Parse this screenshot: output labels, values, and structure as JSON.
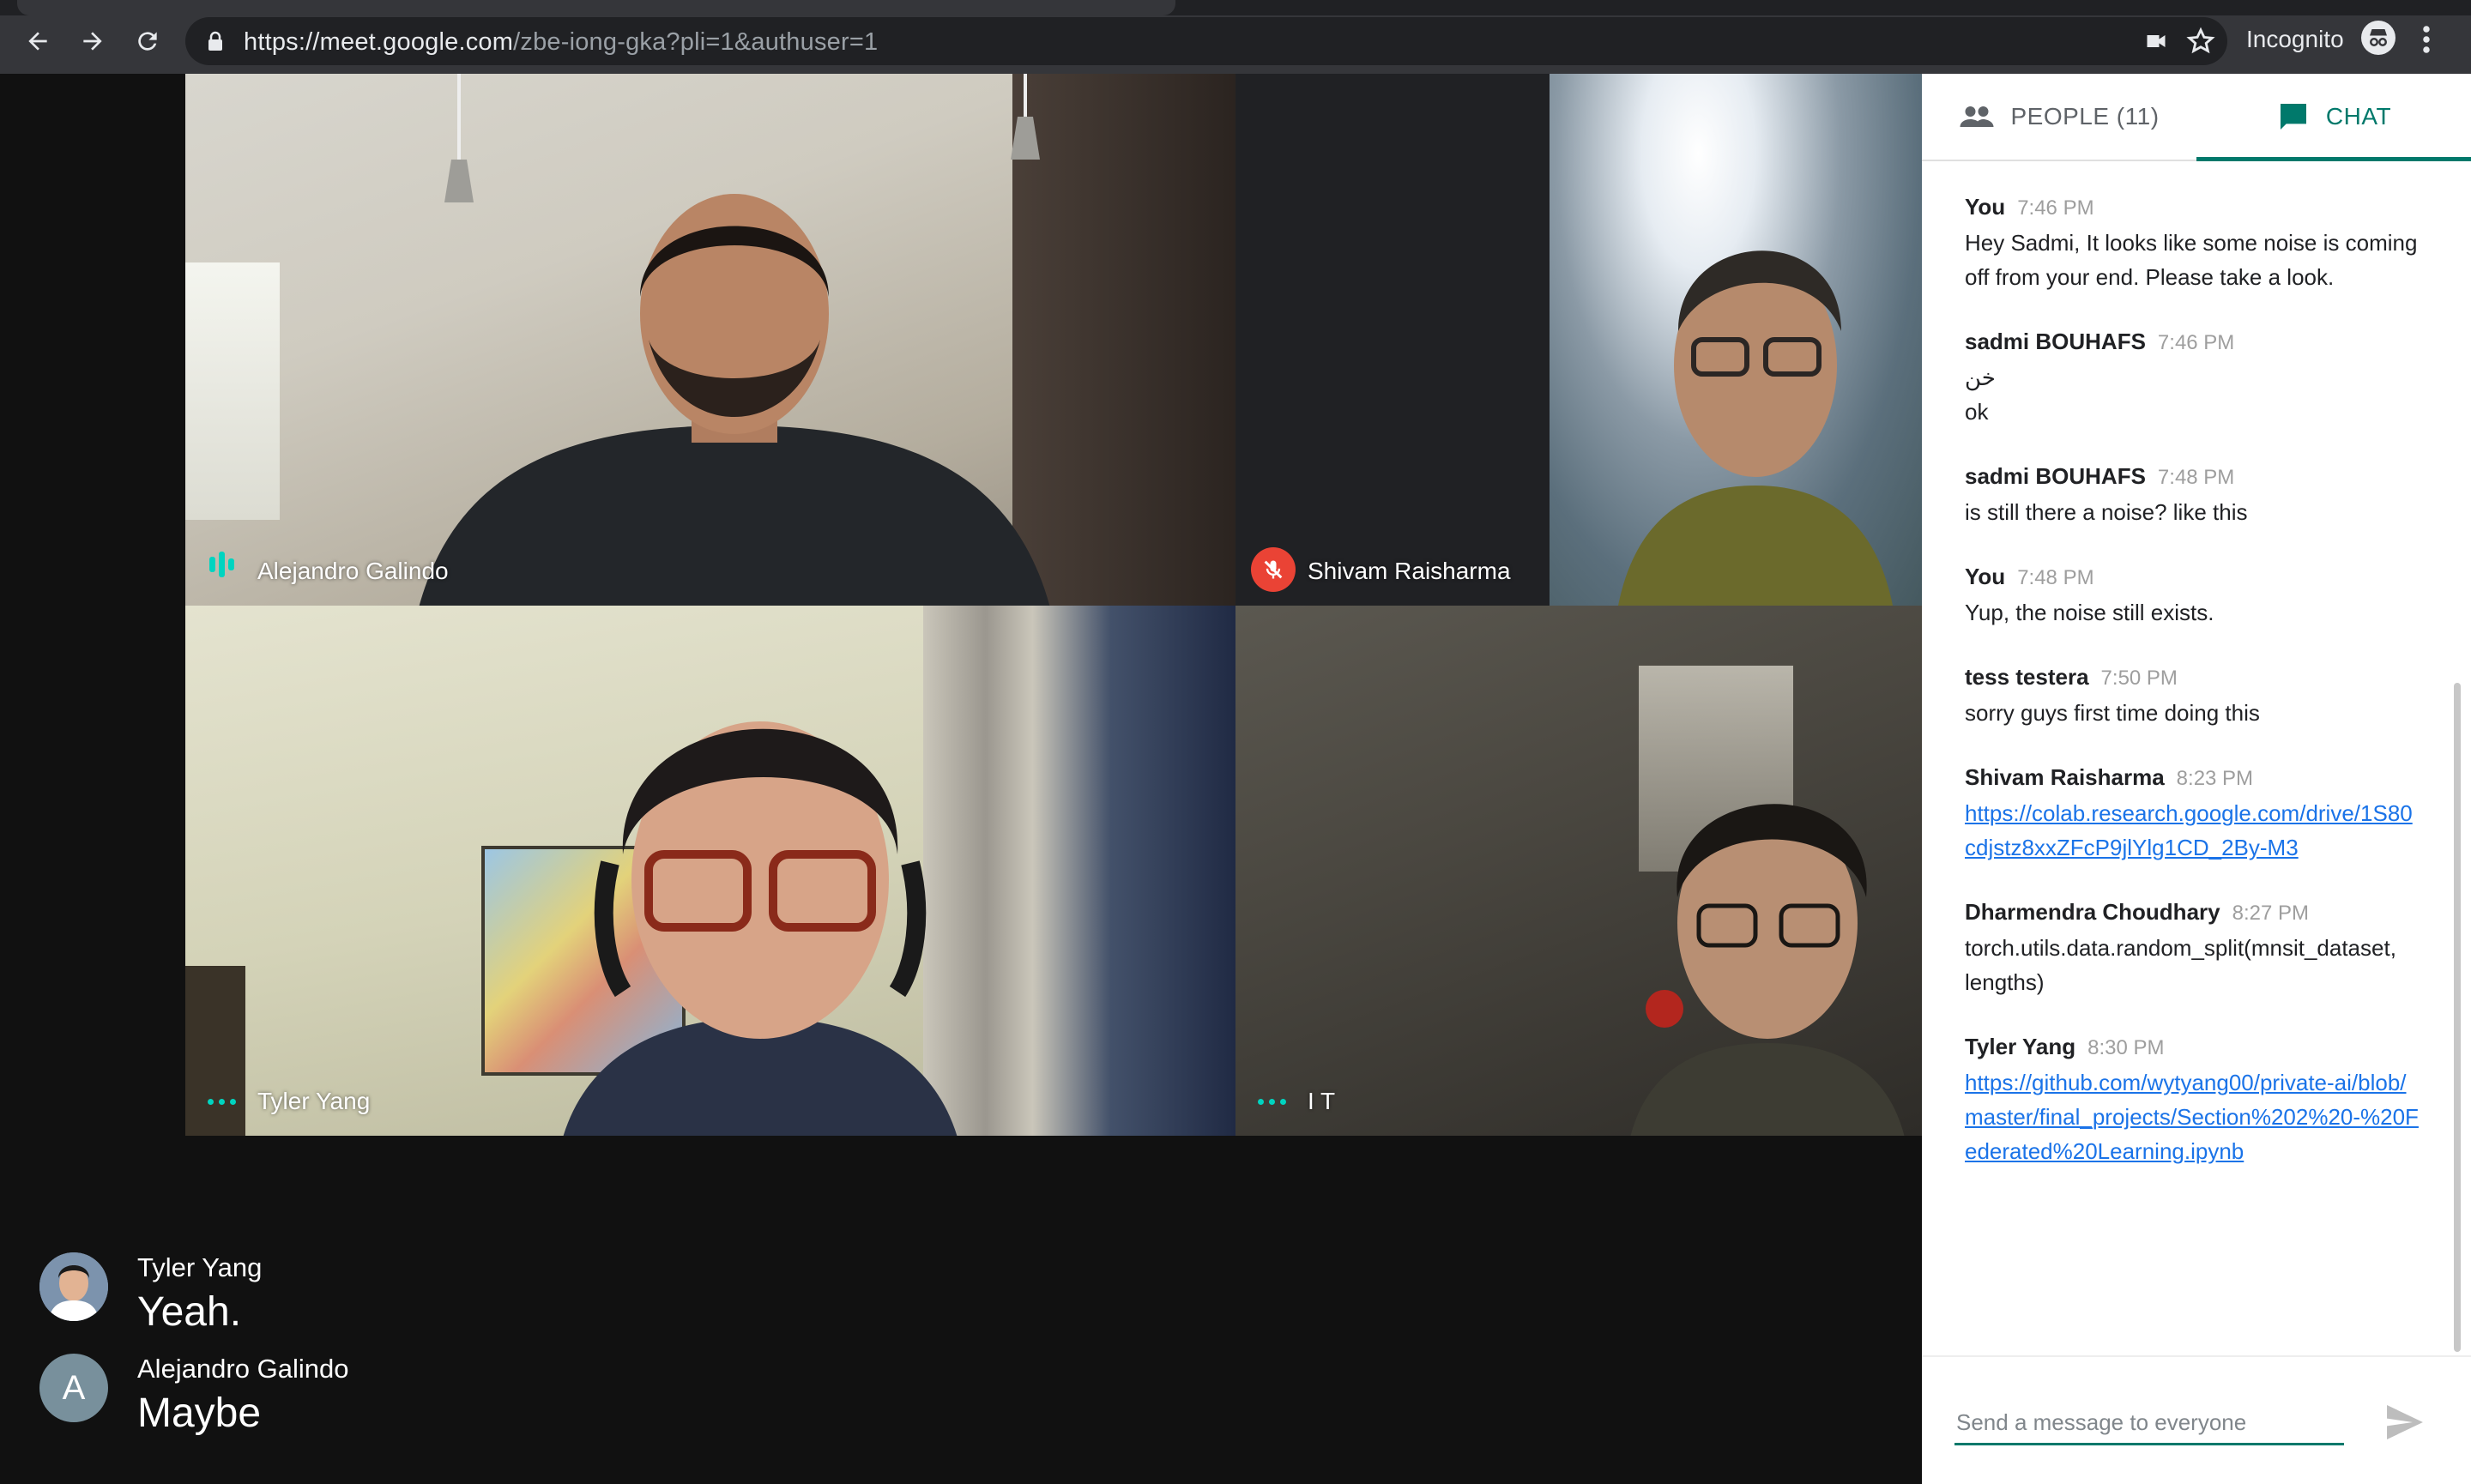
{
  "browser": {
    "url_host": "https://meet.google.com",
    "url_path": "/zbe-iong-gka?pli=1&authuser=1",
    "profile_label": "Incognito"
  },
  "tiles": [
    {
      "name": "Alejandro Galindo",
      "status": "speaking"
    },
    {
      "name": "Shivam Raisharma",
      "status": "muted"
    },
    {
      "name": "Tyler Yang",
      "status": "idle"
    },
    {
      "name": "I T",
      "status": "idle"
    }
  ],
  "captions": [
    {
      "speaker": "Tyler Yang",
      "text": "Yeah.",
      "avatar": "photo"
    },
    {
      "speaker": "Alejandro Galindo",
      "text": "Maybe",
      "avatar_letter": "A"
    }
  ],
  "panel": {
    "people_tab": "PEOPLE (11)",
    "chat_tab": "CHAT",
    "messages": [
      {
        "sender": "You",
        "time": "7:46 PM",
        "text": "Hey Sadmi, It looks like some noise is coming off from your end. Please take a look."
      },
      {
        "sender": "sadmi BOUHAFS",
        "time": "7:46 PM",
        "text": "خن",
        "text2": "ok"
      },
      {
        "sender": "sadmi BOUHAFS",
        "time": "7:48 PM",
        "text": "is still there a noise? like this"
      },
      {
        "sender": "You",
        "time": "7:48 PM",
        "text": "Yup, the noise still exists."
      },
      {
        "sender": "tess testera",
        "time": "7:50 PM",
        "text": "sorry guys first time doing this"
      },
      {
        "sender": "Shivam Raisharma",
        "time": "8:23 PM",
        "link": "https://colab.research.google.com/drive/1S80cdjstz8xxZFcP9jlYlg1CD_2By-M3"
      },
      {
        "sender": "Dharmendra Choudhary",
        "time": "8:27 PM",
        "text": "torch.utils.data.random_split(mnsit_dataset, lengths)"
      },
      {
        "sender": "Tyler Yang",
        "time": "8:30 PM",
        "link": "https://github.com/wytyang00/private-ai/blob/master/final_projects/Section%202%20-%20Federated%20Learning.ipynb"
      }
    ],
    "composer_placeholder": "Send a message to everyone"
  },
  "colors": {
    "accent": "#00796b",
    "link": "#1a73e8",
    "mute_red": "#ea4335",
    "speaking_teal": "#00d4c0"
  },
  "icons": [
    "back-arrow-icon",
    "forward-arrow-icon",
    "reload-icon",
    "lock-icon",
    "camera-blocked-icon",
    "bookmark-star-icon",
    "incognito-icon",
    "menu-dots-icon",
    "people-icon",
    "chat-icon",
    "mic-off-icon",
    "send-icon"
  ]
}
